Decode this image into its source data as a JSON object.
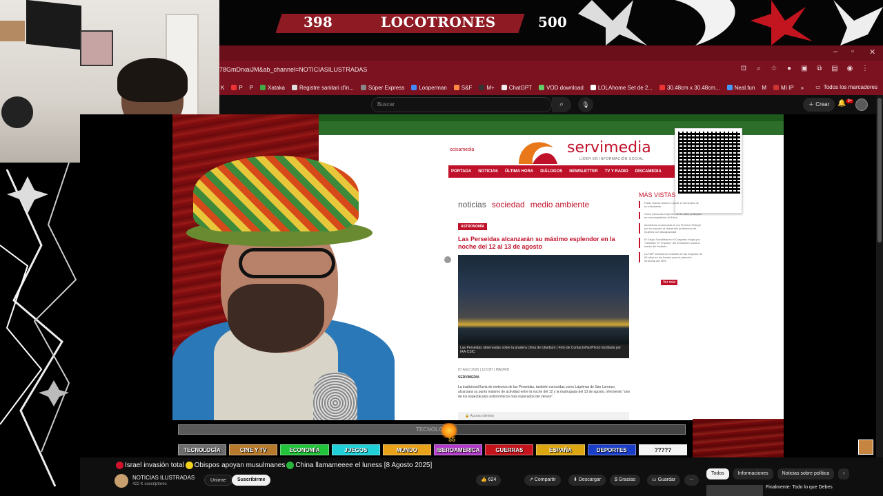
{
  "banner": {
    "score_left": "398",
    "title": "LOCOTRONES",
    "score_right": "500"
  },
  "browser": {
    "url": "78GmDrxaiJM&ab_channel=NOTICIASILUSTRADAS",
    "bookmarks": [
      "K",
      "P",
      "P",
      "Xataka",
      "Registre sanitari d'in...",
      "Súper Express",
      "Looperman",
      "S&F",
      "M+",
      "ChatGPT",
      "VOD download",
      "LOLAhome Set de 2...",
      "30.48cm x 30.48cm...",
      "Neal.fun",
      "M",
      "MI IP"
    ],
    "bookmarks_more": "»",
    "all_bookmarks": "Todos los marcadores"
  },
  "youtube": {
    "search_placeholder": "Buscar",
    "create_label": "Crear",
    "notif_count": "9+"
  },
  "article": {
    "site_small": "ocisamedia",
    "logo": "servimedia",
    "logo_sub": "LÍDER EN INFORMACIÓN SOCIAL",
    "nav": [
      "PORTADA",
      "NOTICIAS",
      "ÚLTIMA HORA",
      "DIÁLOGOS",
      "NEWSLETTER",
      "TV Y RADIO",
      "DISCAMEDIA"
    ],
    "breadcrumbs": [
      "noticias",
      "sociedad",
      "medio ambiente"
    ],
    "tag": "ASTRONOMÍA",
    "headline": "Las Perseidas alcanzarán su máximo esplendor en la noche del 12 al 13 de agosto",
    "caption": "Las Perseidas observadas sobre la pradera china de Ulanbum | Foto de Contacto/NurPhoto facilitada por IAA-CSIC",
    "meta": "07 AGO 2025 | 12:03H | MADRID",
    "byline": "SERVIMEDIA",
    "body": "La tradicional lluvia de meteoros de las Perseidas, también conocidas como Lágrimas de San Lorenzo, alcanzará su punto máximo de actividad entre la noche del 12 y la madrugada del 13 de agosto, ofreciendo \"uno de los espectáculos astronómicos más esperados del verano\".",
    "access": "Acceso clientes",
    "side_title": "MÁS VISTAS",
    "side_items": [
      "Pablo García ambos el pedir el seminario de un estudiante",
      "Cinco personas mayores de 65 años participan en una expedición al Ártico",
      "Acovetura, reconocida en los Premios Fedepe por su impulso al desarrollo profesional de mujeres con discapacidad",
      "El Grupo Socialista en el Congreso elogia por \"estrellas\" el \"impulso\" del feminismo social a través del Instituto",
      "La FMP reclama la inclusión de las mayores de 65 años en los fondos para la atención funcional del SNS"
    ],
    "ver_mas": "Ver más"
  },
  "overlay": {
    "progress_label": "TECNOLOGÍA",
    "progress": 0.54,
    "count": "55",
    "categories": [
      {
        "label": "TECNOLOGÍA",
        "color": "#6c6c6c"
      },
      {
        "label": "CINE Y TV",
        "color": "#b77a2c"
      },
      {
        "label": "ECONOMÍA",
        "color": "#21c43a"
      },
      {
        "label": "JUEGOS",
        "color": "#1fd0d8"
      },
      {
        "label": "MUNDO",
        "color": "#e8a21a"
      },
      {
        "label": "IBEROAMERICA",
        "color": "#b13ac8"
      },
      {
        "label": "GUERRAS",
        "color": "#c6141c"
      },
      {
        "label": "ESPAÑA",
        "color": "#dca610"
      },
      {
        "label": "DEPORTES",
        "color": "#1a3ec8"
      },
      {
        "label": "?????",
        "color": "#f4f4f4"
      }
    ]
  },
  "video": {
    "title_part1": "Israel invasión total",
    "title_part2": "Obispos apoyan musulmanes",
    "title_part3": "China llamameeee el luness [8 Agosto 2025]",
    "channel": "NOTICIAS ILUSTRADAS",
    "subs": "422 K suscriptores",
    "join": "Unirme",
    "subscribe": "Suscribirme",
    "likes": "624",
    "share": "Compartir",
    "download": "Descargar",
    "thanks": "Gracias",
    "save": "Guardar",
    "more": "···"
  },
  "sidebar_tabs": [
    "Todos",
    "Informaciones",
    "Noticias sobre política"
  ],
  "recommendation": "Finalmente: Todo lo que Debes"
}
